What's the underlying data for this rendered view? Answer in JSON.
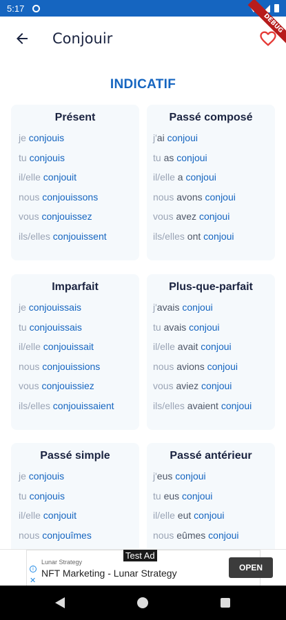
{
  "status_bar": {
    "time": "5:17"
  },
  "app_bar": {
    "title": "Conjouir",
    "debug_label": "DEBUG"
  },
  "section": {
    "title": "INDICATIF"
  },
  "tenses": [
    {
      "name": "Présent",
      "rows": [
        {
          "pron": "je",
          "aux": "",
          "verb": "conjouis"
        },
        {
          "pron": "tu",
          "aux": "",
          "verb": "conjouis"
        },
        {
          "pron": "il/elle",
          "aux": "",
          "verb": "conjouit"
        },
        {
          "pron": "nous",
          "aux": "",
          "verb": "conjouissons"
        },
        {
          "pron": "vous",
          "aux": "",
          "verb": "conjouissez"
        },
        {
          "pron": "ils/elles",
          "aux": "",
          "verb": "conjouissent"
        }
      ]
    },
    {
      "name": "Passé composé",
      "rows": [
        {
          "pron": "j'",
          "aux": "ai",
          "verb": "conjoui"
        },
        {
          "pron": "tu",
          "aux": "as",
          "verb": "conjoui"
        },
        {
          "pron": "il/elle",
          "aux": "a",
          "verb": "conjoui"
        },
        {
          "pron": "nous",
          "aux": "avons",
          "verb": "conjoui"
        },
        {
          "pron": "vous",
          "aux": "avez",
          "verb": "conjoui"
        },
        {
          "pron": "ils/elles",
          "aux": "ont",
          "verb": "conjoui"
        }
      ]
    },
    {
      "name": "Imparfait",
      "rows": [
        {
          "pron": "je",
          "aux": "",
          "verb": "conjouissais"
        },
        {
          "pron": "tu",
          "aux": "",
          "verb": "conjouissais"
        },
        {
          "pron": "il/elle",
          "aux": "",
          "verb": "conjouissait"
        },
        {
          "pron": "nous",
          "aux": "",
          "verb": "conjouissions"
        },
        {
          "pron": "vous",
          "aux": "",
          "verb": "conjouissiez"
        },
        {
          "pron": "ils/elles",
          "aux": "",
          "verb": "conjouissaient"
        }
      ]
    },
    {
      "name": "Plus-que-parfait",
      "rows": [
        {
          "pron": "j'",
          "aux": "avais",
          "verb": "conjoui"
        },
        {
          "pron": "tu",
          "aux": "avais",
          "verb": "conjoui"
        },
        {
          "pron": "il/elle",
          "aux": "avait",
          "verb": "conjoui"
        },
        {
          "pron": "nous",
          "aux": "avions",
          "verb": "conjoui"
        },
        {
          "pron": "vous",
          "aux": "aviez",
          "verb": "conjoui"
        },
        {
          "pron": "ils/elles",
          "aux": "avaient",
          "verb": "conjoui"
        }
      ]
    },
    {
      "name": "Passé simple",
      "rows": [
        {
          "pron": "je",
          "aux": "",
          "verb": "conjouis"
        },
        {
          "pron": "tu",
          "aux": "",
          "verb": "conjouis"
        },
        {
          "pron": "il/elle",
          "aux": "",
          "verb": "conjouit"
        },
        {
          "pron": "nous",
          "aux": "",
          "verb": "conjouîmes"
        }
      ]
    },
    {
      "name": "Passé antérieur",
      "rows": [
        {
          "pron": "j'",
          "aux": "eus",
          "verb": "conjoui"
        },
        {
          "pron": "tu",
          "aux": "eus",
          "verb": "conjoui"
        },
        {
          "pron": "il/elle",
          "aux": "eut",
          "verb": "conjoui"
        },
        {
          "pron": "nous",
          "aux": "eûmes",
          "verb": "conjoui"
        }
      ]
    }
  ],
  "ad": {
    "badge": "Test Ad",
    "sponsor": "Lunar Strategy",
    "title": "NFT Marketing - Lunar Strategy",
    "cta": "OPEN"
  },
  "colors": {
    "accent": "#1565c0",
    "title": "#1a2340",
    "pronoun": "#9aa4b5",
    "heart": "#e53935",
    "card_bg": "#f5f9fc"
  }
}
